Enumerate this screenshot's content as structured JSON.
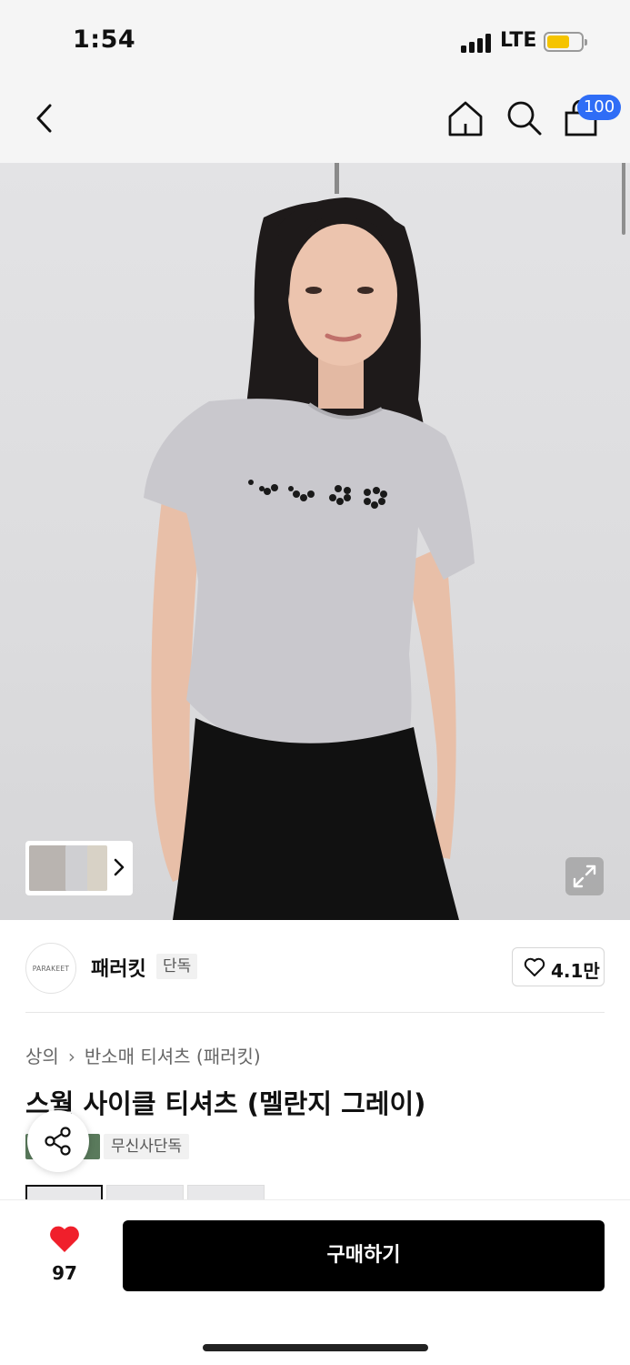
{
  "status_bar": {
    "time": "1:54",
    "network": "LTE",
    "battery_color": "#f5c400"
  },
  "nav": {
    "back_icon": "chevron-left-icon",
    "home_icon": "home-icon",
    "search_icon": "search-icon",
    "cart_icon": "shopping-bag-icon",
    "cart_count": "100",
    "cart_badge_color": "#2f6df6"
  },
  "hero": {
    "expand_icon": "expand-icon",
    "thumb_next_icon": "chevron-right-icon"
  },
  "brand": {
    "logo_text": "PARAKEET",
    "name": "패러킷",
    "tag": "단독",
    "like_icon": "heart-outline-icon",
    "like_count": "4.1만"
  },
  "product": {
    "breadcrumb": [
      "상의",
      "반소매 티셔츠 (패러킷)"
    ],
    "breadcrumb_sep_icon": "chevron-right-icon",
    "title": "스월 사이클 티셔츠 (멜란지 그레이)",
    "badge_exclusive": "무신사단독",
    "share_icon": "share-icon"
  },
  "bottom_bar": {
    "like_icon": "heart-filled-icon",
    "like_color": "#f01f2b",
    "like_count": "97",
    "buy_label": "구매하기"
  }
}
